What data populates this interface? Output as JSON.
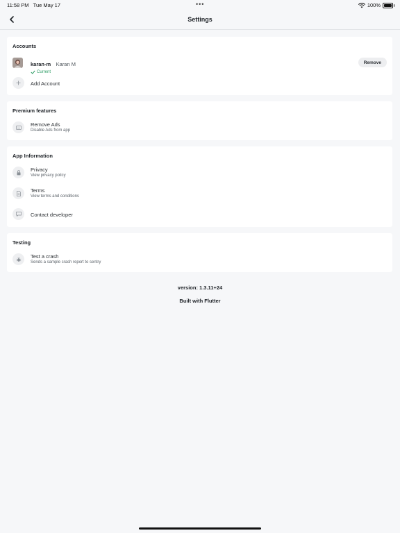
{
  "status_bar": {
    "time": "11:58 PM",
    "date": "Tue May 17",
    "battery": "100%"
  },
  "header": {
    "title": "Settings"
  },
  "accounts": {
    "heading": "Accounts",
    "user": {
      "username": "karan-m",
      "fullname": "Karan M",
      "status": "Current"
    },
    "remove_label": "Remove",
    "add_label": "Add Account"
  },
  "premium": {
    "heading": "Premium features",
    "items": [
      {
        "title": "Remove Ads",
        "subtitle": "Disable Ads from app"
      }
    ]
  },
  "app_info": {
    "heading": "App Information",
    "items": [
      {
        "title": "Privacy",
        "subtitle": "View privacy policy"
      },
      {
        "title": "Terms",
        "subtitle": "View terms and conditions"
      },
      {
        "title": "Contact developer"
      }
    ]
  },
  "testing": {
    "heading": "Testing",
    "items": [
      {
        "title": "Test a crash",
        "subtitle": "Sends a sample crash report to sentry"
      }
    ]
  },
  "footer": {
    "version": "version: 1.3.11+24",
    "built_with": "Built with Flutter"
  },
  "colors": {
    "accent_green": "#2f9d66",
    "background": "#f6f7f9",
    "card": "#ffffff"
  }
}
